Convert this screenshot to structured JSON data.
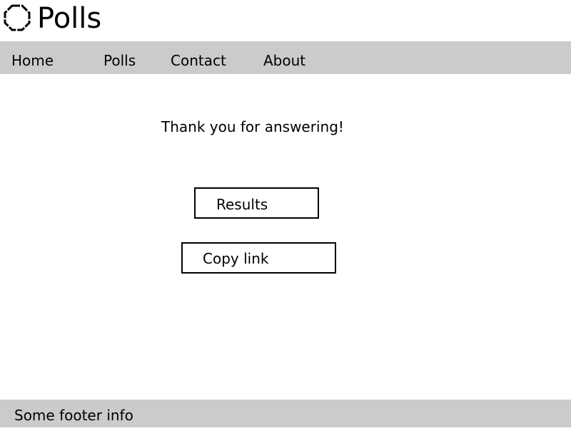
{
  "header": {
    "logo_icon": "octagon-logo-icon",
    "title": "Polls"
  },
  "nav": {
    "items": [
      {
        "label": "Home"
      },
      {
        "label": "Polls"
      },
      {
        "label": "Contact"
      },
      {
        "label": "About"
      }
    ]
  },
  "main": {
    "message": "Thank you for answering!",
    "results_button": "Results",
    "copy_link_button": "Copy link"
  },
  "footer": {
    "text": "Some footer info"
  },
  "colors": {
    "bars": "#cbcbcb",
    "background": "#ffffff",
    "text": "#000000",
    "border": "#000000"
  }
}
